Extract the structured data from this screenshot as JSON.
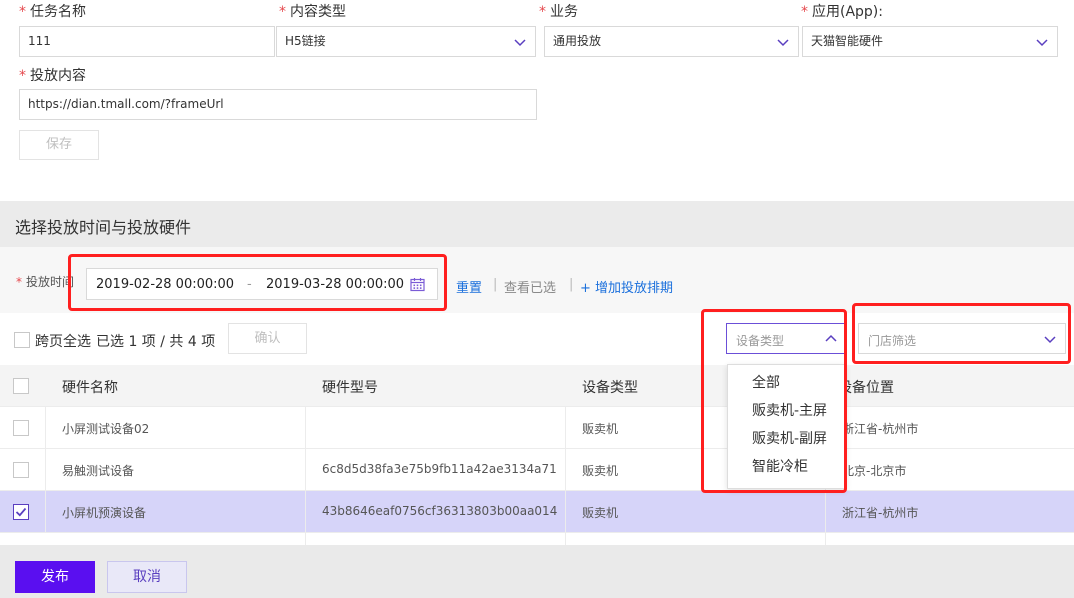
{
  "form": {
    "task_name_label": "任务名称",
    "task_name_value": "111",
    "content_type_label": "内容类型",
    "content_type_value": "H5链接",
    "business_label": "业务",
    "business_value": "通用投放",
    "app_label": "应用(App):",
    "app_value": "天猫智能硬件",
    "content_label": "投放内容",
    "content_value": "https://dian.tmall.com/?frameUrl",
    "save_label": "保存",
    "required_mark": "*"
  },
  "section": {
    "title": "选择投放时间与投放硬件"
  },
  "filter": {
    "time_label": "投放时间",
    "start": "2019-02-28 00:00:00",
    "dash": "-",
    "end": "2019-03-28 00:00:00",
    "reset": "重置",
    "view_selected": "查看已选",
    "add_schedule": "+ 增加投放排期",
    "sep": "|"
  },
  "toolbar": {
    "cross_page_select": "跨页全选",
    "selection_summary": "已选 1 项 / 共 4 项",
    "confirm": "确认",
    "device_type_placeholder": "设备类型",
    "store_filter_placeholder": "门店筛选"
  },
  "dropdown": {
    "items": [
      "全部",
      "贩卖机-主屏",
      "贩卖机-副屏",
      "智能冷柜"
    ]
  },
  "table": {
    "headers": [
      "硬件名称",
      "硬件型号",
      "设备类型",
      "设备位置"
    ],
    "rows": [
      {
        "name": "小屏测试设备02",
        "model": "",
        "type": "贩卖机",
        "location": "浙江省-杭州市",
        "checked": false
      },
      {
        "name": "易触测试设备",
        "model": "6c8d5d38fa3e75b9fb11a42ae3134a71",
        "type": "贩卖机",
        "location": "北京-北京市",
        "checked": false
      },
      {
        "name": "小屏机预演设备",
        "model": "43b8646eaf0756cf36313803b00aa014",
        "type": "贩卖机",
        "location": "浙江省-杭州市",
        "checked": true
      }
    ]
  },
  "footer": {
    "publish": "发布",
    "cancel": "取消"
  },
  "colors": {
    "accent": "#5a0ff0",
    "link": "#1a6fdc",
    "selected_row": "#d6d4f9",
    "annotation": "#ff1f1f"
  }
}
